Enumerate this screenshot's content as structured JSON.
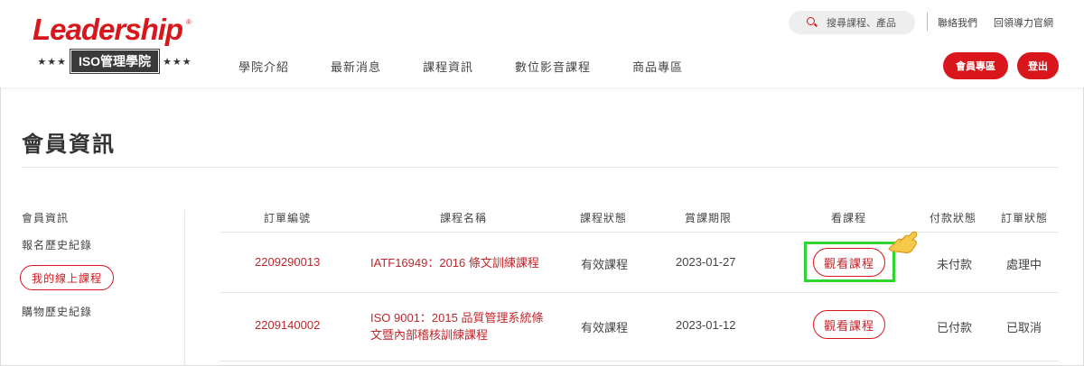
{
  "brand": {
    "name": "Leadership",
    "reg_mark": "®",
    "stars_left": "★★★",
    "stars_right": "★★★",
    "badge": "ISO管理學院",
    "color": "#d8161b"
  },
  "nav": [
    "學院介紹",
    "最新消息",
    "課程資訊",
    "數位影音課程",
    "商品專區"
  ],
  "search": {
    "placeholder": "搜尋課程、產品"
  },
  "top_links": {
    "contact": "聯絡我們",
    "back": "回領導力官網"
  },
  "buttons": {
    "member": "會員專區",
    "logout": "登出"
  },
  "page_title": "會員資訊",
  "sidebar": {
    "items": [
      "會員資訊",
      "報名歷史紀錄",
      "我的線上課程",
      "購物歷史紀錄"
    ],
    "active_index": 2
  },
  "table": {
    "headers": [
      "訂單編號",
      "課程名稱",
      "課程狀態",
      "賞課期限",
      "看課程",
      "付款狀態",
      "訂單狀態"
    ],
    "rows": [
      {
        "order_no": "2209290013",
        "course": "IATF16949：2016 條文訓練課程",
        "status": "有效課程",
        "deadline": "2023-01-27",
        "watch": "觀看課程",
        "payment": "未付款",
        "order_status": "處理中"
      },
      {
        "order_no": "2209140002",
        "course_line1": "ISO 9001：2015 品質管理系統條",
        "course_line2": "文暨內部稽核訓練課程",
        "status": "有效課程",
        "deadline": "2023-01-12",
        "watch": "觀看課程",
        "payment": "已付款",
        "order_status": "已取消"
      }
    ]
  },
  "highlight_color": "#2ed52e",
  "icons": [
    "search-icon",
    "pointing-hand-icon"
  ]
}
